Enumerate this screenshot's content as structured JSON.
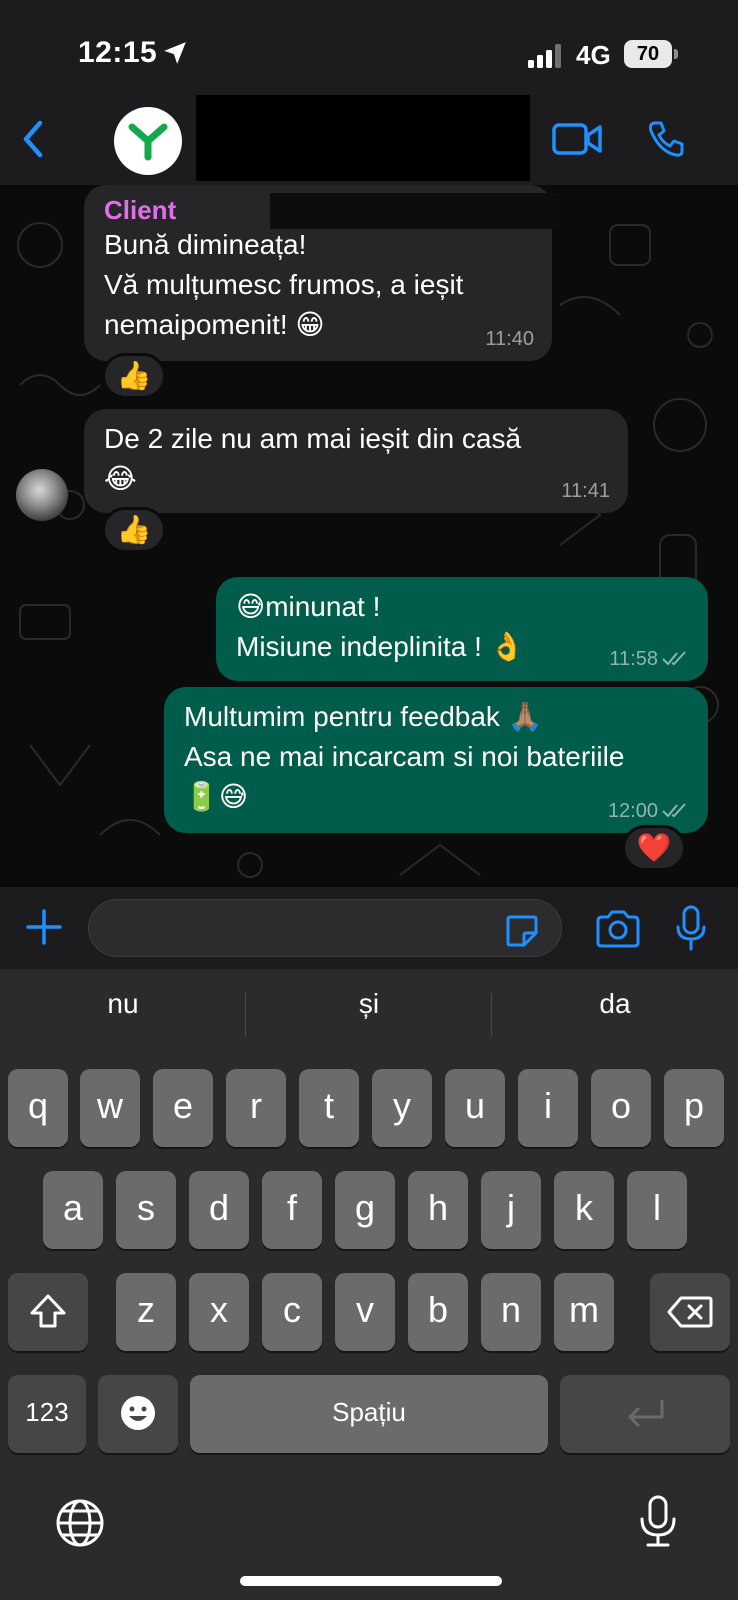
{
  "status": {
    "time": "12:15",
    "network": "4G",
    "battery": "70"
  },
  "header": {
    "contact_name": ""
  },
  "messages": [
    {
      "sender": "Client",
      "lines": [
        "Bună dimineața!",
        "Vă mulțumesc frumos, a ieșit",
        "nemaipomenit! 😁"
      ],
      "time": "11:40",
      "reaction": "👍"
    },
    {
      "lines": [
        "De 2 zile nu am mai ieșit din casă",
        "😂"
      ],
      "time": "11:41",
      "reaction": "👍"
    },
    {
      "lines": [
        "😅minunat !",
        "Misiune indeplinita ! 👌"
      ],
      "time": "11:58"
    },
    {
      "lines": [
        "Multumim pentru feedbak 🙏🏽",
        "Asa ne mai incarcam si noi bateriile",
        "🔋😅"
      ],
      "time": "12:00",
      "reaction": "❤️"
    }
  ],
  "input": {
    "placeholder": ""
  },
  "keyboard": {
    "suggestions": [
      "nu",
      "și",
      "da"
    ],
    "row1": [
      "q",
      "w",
      "e",
      "r",
      "t",
      "y",
      "u",
      "i",
      "o",
      "p"
    ],
    "row2": [
      "a",
      "s",
      "d",
      "f",
      "g",
      "h",
      "j",
      "k",
      "l"
    ],
    "row3": [
      "z",
      "x",
      "c",
      "v",
      "b",
      "n",
      "m"
    ],
    "numbers_key": "123",
    "space": "Spațiu"
  },
  "colors": {
    "accent": "#1e90ff",
    "incoming": "#262628",
    "outgoing": "#005c4b",
    "sender_name": "#e06ee8"
  },
  "icons": [
    "location-arrow-icon",
    "signal-icon",
    "back-chevron-icon",
    "video-icon",
    "phone-icon",
    "plus-icon",
    "sticker-icon",
    "camera-icon",
    "mic-icon",
    "shift-icon",
    "backspace-icon",
    "emoji-icon",
    "return-icon",
    "globe-icon",
    "dictation-mic-icon"
  ]
}
